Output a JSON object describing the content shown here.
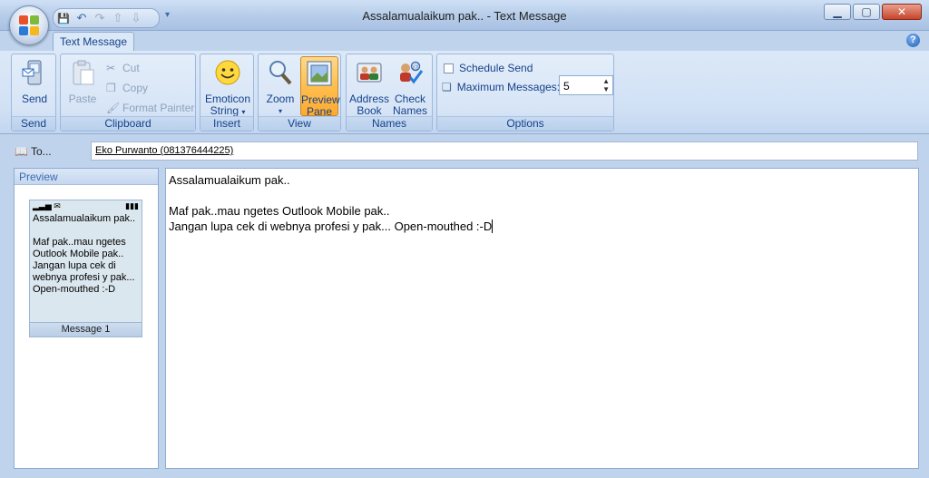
{
  "window": {
    "title": "Assalamualaikum pak.. - Text Message",
    "minimize": "▁",
    "maximize": "▢",
    "close": "✕"
  },
  "quick_access": {
    "save": "💾",
    "undo": "↶",
    "redo": "↷",
    "prev": "⇧",
    "next": "⇩",
    "dropdown": "▾"
  },
  "tabs": [
    {
      "label": "Text Message"
    }
  ],
  "help": "?",
  "ribbon": {
    "send_group": {
      "label": "Send",
      "send": "Send"
    },
    "clipboard_group": {
      "label": "Clipboard",
      "paste": "Paste",
      "cut": "Cut",
      "copy": "Copy",
      "format_painter": "Format Painter"
    },
    "insert_group": {
      "label": "Insert",
      "emoticon_line1": "Emoticon",
      "emoticon_line2": "String"
    },
    "view_group": {
      "label": "View",
      "zoom": "Zoom",
      "preview_line1": "Preview",
      "preview_line2": "Pane"
    },
    "names_group": {
      "label": "Names",
      "address_line1": "Address",
      "address_line2": "Book",
      "check_line1": "Check",
      "check_line2": "Names"
    },
    "options_group": {
      "label": "Options",
      "schedule_send": "Schedule Send",
      "maximum_messages": "Maximum Messages:",
      "maximum_value": "5"
    }
  },
  "to": {
    "button": "To...",
    "value": "Eko Purwanto (081376444225)"
  },
  "preview": {
    "header": "Preview",
    "phone_text": "Assalamualaikum pak..\n\nMaf pak..mau ngetes\nOutlook Mobile pak..\nJangan lupa cek di\nwebnya profesi y pak...\nOpen-mouthed :-D",
    "footer": "Message 1"
  },
  "message": {
    "body": "Assalamualaikum pak..\n\nMaf pak..mau ngetes Outlook Mobile pak..\nJangan lupa cek di webnya profesi y pak... Open-mouthed :-D"
  },
  "colors": {
    "accent": "#15428b",
    "ribbon_bg": "#d6e4f6",
    "pressed": "#ffbf4f"
  }
}
